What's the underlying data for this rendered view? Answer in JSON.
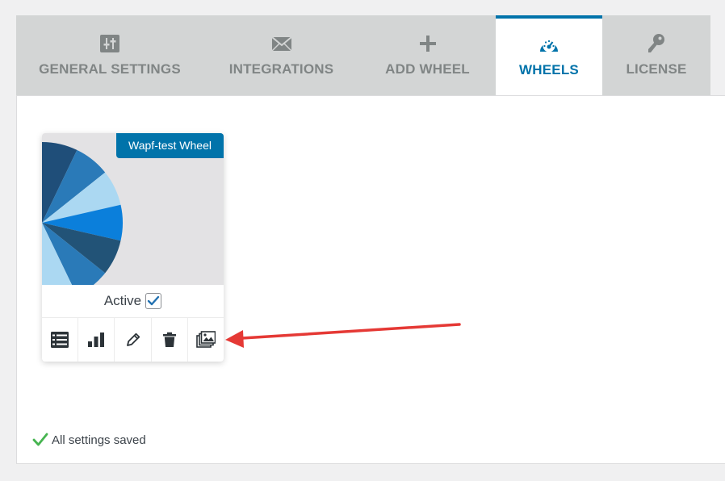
{
  "tabs": [
    {
      "label": "GENERAL SETTINGS",
      "icon": "sliders-icon"
    },
    {
      "label": "INTEGRATIONS",
      "icon": "envelope-icon"
    },
    {
      "label": "ADD WHEEL",
      "icon": "plus-icon"
    },
    {
      "label": "WHEELS",
      "icon": "dashboard-icon",
      "active": true
    },
    {
      "label": "LICENSE",
      "icon": "key-icon"
    }
  ],
  "wheel_card": {
    "title": "Wapf-test Wheel",
    "active_label": "Active",
    "active_checked": true,
    "actions": [
      "list-icon",
      "chart-bar-icon",
      "pencil-icon",
      "trash-icon",
      "images-icon"
    ]
  },
  "status": {
    "text": "All settings saved"
  },
  "colors": {
    "accent": "#0073aa",
    "tab_bg": "#d3d5d5",
    "tab_text": "#808585",
    "success": "#46b450",
    "annotation_arrow": "#e53935",
    "wheel_slices": [
      "#1f4e79",
      "#2a7ab8",
      "#abd8f2",
      "#0b7fdb",
      "#225377",
      "#2a7ab8",
      "#abd8f2"
    ]
  }
}
